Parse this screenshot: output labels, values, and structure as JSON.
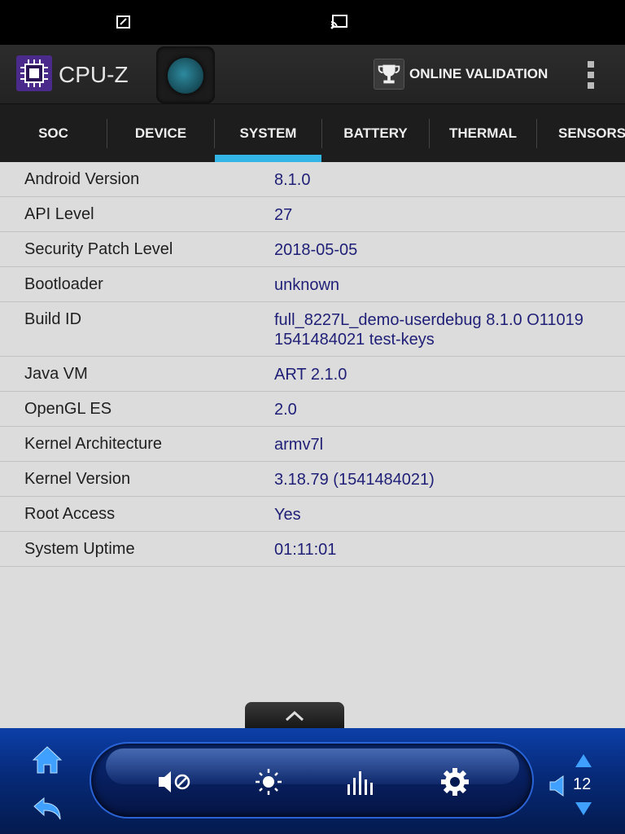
{
  "app": {
    "title": "CPU-Z",
    "validation_label": "ONLINE VALIDATION"
  },
  "tabs": [
    {
      "label": "SOC"
    },
    {
      "label": "DEVICE"
    },
    {
      "label": "SYSTEM",
      "active": true
    },
    {
      "label": "BATTERY"
    },
    {
      "label": "THERMAL"
    },
    {
      "label": "SENSORS"
    }
  ],
  "system_info": [
    {
      "key": "Android Version",
      "value": "8.1.0"
    },
    {
      "key": "API Level",
      "value": "27"
    },
    {
      "key": "Security Patch Level",
      "value": "2018-05-05"
    },
    {
      "key": "Bootloader",
      "value": "unknown"
    },
    {
      "key": "Build ID",
      "value": "full_8227L_demo-userdebug 8.1.0 O11019 1541484021 test-keys"
    },
    {
      "key": "Java VM",
      "value": "ART 2.1.0"
    },
    {
      "key": "OpenGL ES",
      "value": "2.0"
    },
    {
      "key": "Kernel Architecture",
      "value": "armv7l"
    },
    {
      "key": "Kernel Version",
      "value": "3.18.79 (1541484021)"
    },
    {
      "key": "Root Access",
      "value": "Yes"
    },
    {
      "key": "System Uptime",
      "value": "01:11:01"
    }
  ],
  "nav": {
    "volume_level": "12"
  },
  "icons": [
    "screenshot-icon",
    "cast-icon",
    "cpu-chip-icon",
    "trophy-icon",
    "overflow-menu-icon",
    "chevron-up-icon",
    "home-icon",
    "back-icon",
    "mute-icon",
    "brightness-icon",
    "equalizer-icon",
    "settings-icon",
    "volume-icon",
    "volume-up-icon",
    "volume-down-icon"
  ],
  "colors": {
    "accent": "#33b5e5",
    "value_text": "#1f1f77",
    "navbar": "#062a78"
  }
}
